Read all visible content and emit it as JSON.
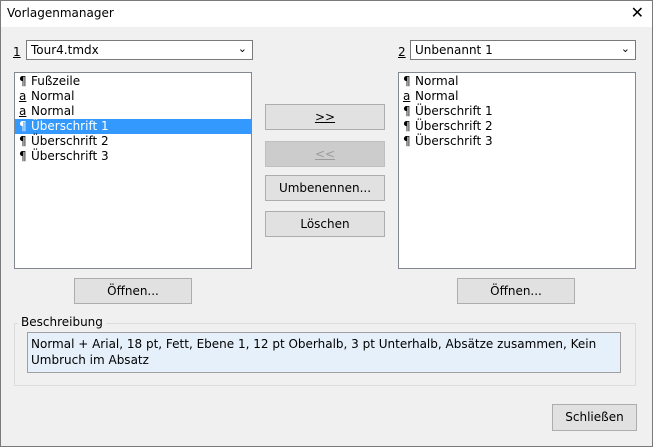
{
  "window": {
    "title": "Vorlagenmanager",
    "close_glyph": "✕"
  },
  "left": {
    "number": "1",
    "dropdown_value": "Tour4.tmdx",
    "items": [
      {
        "icon": "¶",
        "label": "Fußzeile",
        "selected": false
      },
      {
        "icon": "a",
        "label": "Normal",
        "selected": false
      },
      {
        "icon": "a",
        "label": "Normal",
        "selected": false
      },
      {
        "icon": "¶",
        "label": "Überschrift 1",
        "selected": true
      },
      {
        "icon": "¶",
        "label": "Überschrift 2",
        "selected": false
      },
      {
        "icon": "¶",
        "label": "Überschrift 3",
        "selected": false
      }
    ],
    "open_button": "Öffnen..."
  },
  "right": {
    "number": "2",
    "dropdown_value": "Unbenannt 1",
    "items": [
      {
        "icon": "¶",
        "label": "Normal"
      },
      {
        "icon": "a",
        "label": "Normal"
      },
      {
        "icon": "¶",
        "label": "Überschrift 1"
      },
      {
        "icon": "¶",
        "label": "Überschrift 2"
      },
      {
        "icon": "¶",
        "label": "Überschrift 3"
      }
    ],
    "open_button": "Öffnen..."
  },
  "middle": {
    "copy_right": ">>",
    "copy_left": "<<",
    "rename": "Umbenennen...",
    "delete": "Löschen"
  },
  "description": {
    "label": "Beschreibung",
    "text": "Normal + Arial, 18 pt, Fett, Ebene 1, 12 pt Oberhalb, 3 pt Unterhalb, Absätze zusammen, Kein Umbruch im Absatz"
  },
  "close_button": "Schließen"
}
